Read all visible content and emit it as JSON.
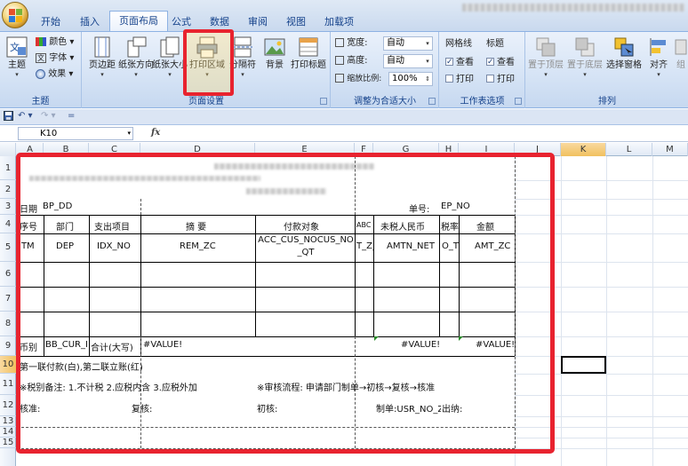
{
  "tabs": [
    "开始",
    "插入",
    "页面布局",
    "公式",
    "数据",
    "审阅",
    "视图",
    "加载项"
  ],
  "active_tab": "页面布局",
  "ribbon": {
    "theme_group": {
      "label": "主题",
      "theme_button": "主题",
      "colors": "颜色",
      "fonts": "字体",
      "effects": "效果"
    },
    "page_setup_group": {
      "label": "页面设置",
      "margins": "页边距",
      "orientation": "纸张方向",
      "size": "纸张大小",
      "print_area": "打印区域",
      "breaks": "分隔符",
      "background": "背景",
      "print_titles": "打印标题"
    },
    "scale_group": {
      "label": "调整为合适大小",
      "width_label": "宽度:",
      "width_value": "自动",
      "height_label": "高度:",
      "height_value": "自动",
      "scale_label": "缩放比例:",
      "scale_value": "100%"
    },
    "sheet_options_group": {
      "label": "工作表选项",
      "gridlines": "网格线",
      "headings": "标题",
      "view": "查看",
      "print": "打印"
    },
    "arrange_group": {
      "label": "排列",
      "bring_front": "置于顶层",
      "send_back": "置于底层",
      "selection_pane": "选择窗格",
      "align": "对齐",
      "group": "组"
    }
  },
  "name_box": "K10",
  "fx_label": "fx",
  "columns": [
    "A",
    "B",
    "C",
    "D",
    "E",
    "F",
    "G",
    "H",
    "I",
    "J",
    "K",
    "L",
    "M"
  ],
  "selected_column": "K",
  "rows": [
    "1",
    "2",
    "3",
    "4",
    "5",
    "6",
    "7",
    "8",
    "9",
    "10",
    "11",
    "12",
    "13",
    "14",
    "15"
  ],
  "selected_row": "10",
  "cells": {
    "date_label": "日期",
    "date_val": "BP_DD",
    "voucher_label": "单号:",
    "voucher_val": "EP_NO",
    "h_seq": "序号",
    "h_dept": "部门",
    "h_item": "支出项目",
    "h_summary": "摘  要",
    "h_payee": "付款对象",
    "h_abc": "ABC",
    "h_untaxed": "未税人民币",
    "h_taxrate": "税率",
    "h_amount": "金额",
    "r5_itm": "ITM",
    "r5_dep": "DEP",
    "r5_idx": "IDX_NO",
    "r5_rem": "REM_ZC",
    "r5_acc1": "ACC_CUS_NOCUS_NO",
    "r5_acc2": "_QT",
    "r5_f": "T_Z_",
    "r5_amtn": "AMTN_NET",
    "r5_h": "O_T/",
    "r5_amt": "AMT_ZC",
    "r9_curr": "币别",
    "r9_curval": "BB_CUR_I",
    "r9_total": "合计(大写)",
    "r9_value1": "#VALUE!",
    "r9_value2": "#VALUE!",
    "r9_value3": "#VALUE!",
    "r10_note": "第一联付款(白),第二联立账(红)",
    "r11_tax": "※税别备注: 1.不计税 2.应税内含 3.应税外加",
    "r11_audit": "※审核流程: 申请部门制单→初核→复核→核准",
    "r12_approve": "核准:",
    "r12_review": "复核:",
    "r12_first": "初核:",
    "r12_maker": "制单:USR_NO_Z",
    "r12_cashier": "出纳:"
  }
}
